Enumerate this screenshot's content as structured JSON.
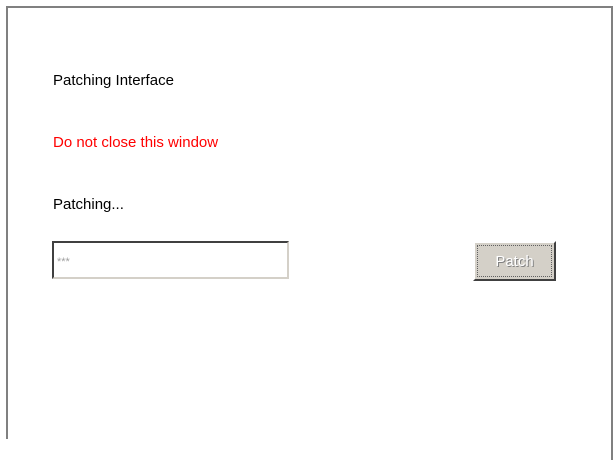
{
  "window": {
    "title_text": "Patching Interface",
    "warning_text": "Do not close this window",
    "status_text": "Patching..."
  },
  "input": {
    "value": "",
    "placeholder": "***"
  },
  "button": {
    "label": "Patch",
    "enabled": false
  },
  "colors": {
    "warning": "#ff0000",
    "button_face": "#d4d0c8",
    "frame": "#808080"
  }
}
